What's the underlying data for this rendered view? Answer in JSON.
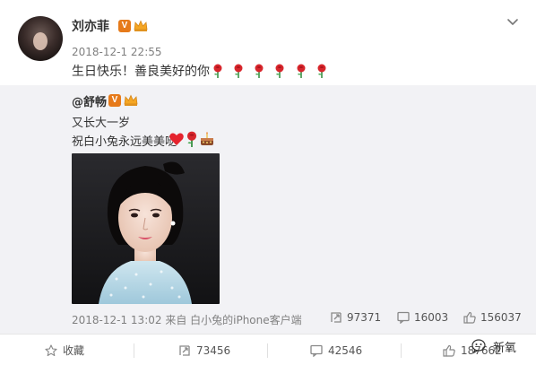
{
  "post": {
    "username": "刘亦菲",
    "verified_badge": "V",
    "time": "2018-12-1 22:55",
    "text": "生日快乐！善良美好的你",
    "rose_count": 6
  },
  "repost": {
    "username": "@舒畅",
    "verified_badge": "V",
    "line1": "又长大一岁",
    "line2": "祝白小兔永远美美哒",
    "meta": "2018-12-1 13:02 来自 白小兔的iPhone客户端",
    "stats": {
      "reposts": "97371",
      "comments": "16003",
      "likes": "156037"
    }
  },
  "actions": {
    "favorite": "收藏",
    "repost": "73456",
    "comment": "42546",
    "like": "187662"
  },
  "watermark": {
    "text": "新氧"
  },
  "colors": {
    "repost_bg": "#f2f2f5",
    "verified": "#e67a1a",
    "crown": "#f5a623",
    "meta": "#808080"
  },
  "icons": [
    "chevron-down-icon",
    "rose-icon",
    "heart-icon",
    "cake-icon",
    "repost-icon",
    "comment-icon",
    "like-icon",
    "star-icon"
  ]
}
